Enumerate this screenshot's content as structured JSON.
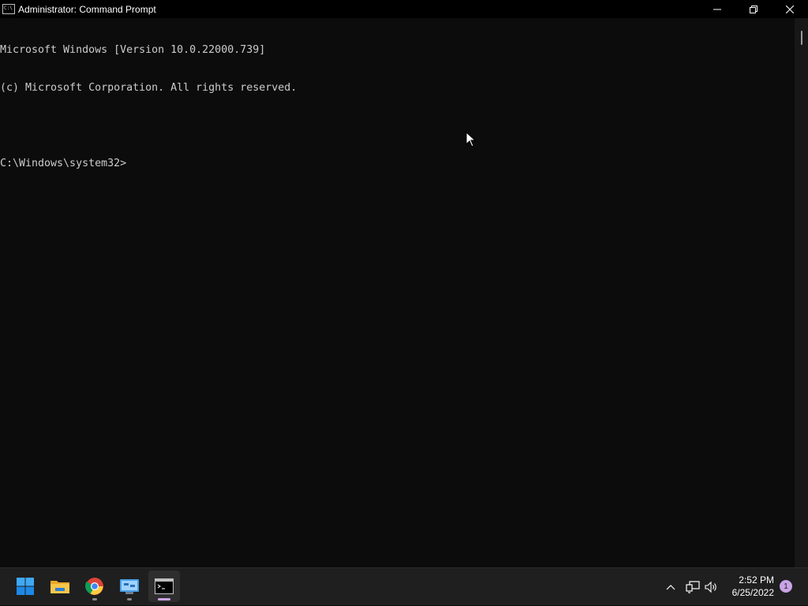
{
  "window": {
    "title": "Administrator: Command Prompt",
    "icon": "cmd-icon"
  },
  "console": {
    "lines": [
      "Microsoft Windows [Version 10.0.22000.739]",
      "(c) Microsoft Corporation. All rights reserved.",
      "",
      "C:\\Windows\\system32>"
    ]
  },
  "taskbar": {
    "apps": [
      {
        "name": "start",
        "icon": "windows-logo-icon"
      },
      {
        "name": "file-explorer",
        "icon": "folder-icon"
      },
      {
        "name": "chrome",
        "icon": "chrome-icon",
        "running": true
      },
      {
        "name": "control-panel",
        "icon": "control-panel-icon",
        "running": true
      },
      {
        "name": "command-prompt",
        "icon": "cmd-icon",
        "running": true,
        "active": true
      }
    ],
    "tray": {
      "time": "2:52 PM",
      "date": "6/25/2022",
      "notifications": "1"
    }
  },
  "colors": {
    "console_bg": "#0c0c0c",
    "console_text": "#cccccc",
    "accent": "#c9a3e6",
    "taskbar_bg": "#1f1f1f"
  }
}
